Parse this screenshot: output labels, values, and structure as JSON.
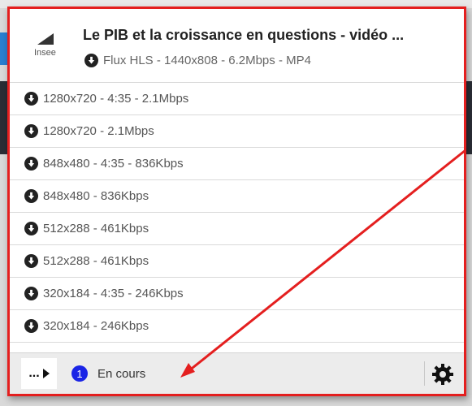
{
  "popup": {
    "title": "Le PIB et la croissance en questions - vidéo ...",
    "logo_text": "Insee",
    "main_format": "Flux HLS - 1440x808 - 6.2Mbps - MP4"
  },
  "formats": [
    {
      "label": "1280x720 - 4:35 - 2.1Mbps"
    },
    {
      "label": "1280x720 - 2.1Mbps"
    },
    {
      "label": "848x480 - 4:35 - 836Kbps"
    },
    {
      "label": "848x480 - 836Kbps"
    },
    {
      "label": "512x288 - 461Kbps"
    },
    {
      "label": "512x288 - 461Kbps"
    },
    {
      "label": "320x184 - 4:35 - 246Kbps"
    },
    {
      "label": "320x184 - 246Kbps"
    }
  ],
  "footer": {
    "more_label": "...",
    "badge_count": "1",
    "status_text": "En cours"
  },
  "icons": [
    "download-icon",
    "play-arrow-icon",
    "gear-icon"
  ],
  "colors": {
    "highlight": "#e41f1f",
    "badge": "#1a24e6"
  }
}
